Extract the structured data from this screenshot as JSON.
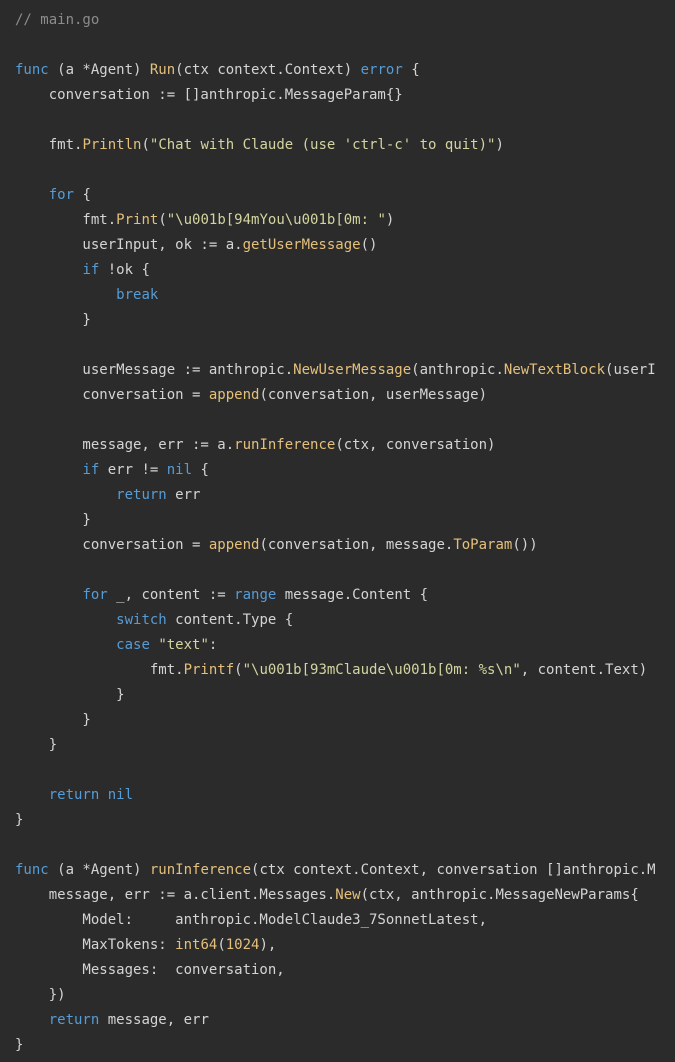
{
  "file": {
    "comment": "// main.go"
  },
  "code_lines": [
    [
      {
        "t": "comment",
        "v": "// main.go"
      }
    ],
    [],
    [
      {
        "t": "keyword",
        "v": "func"
      },
      {
        "t": "plain",
        "v": " (a *Agent) "
      },
      {
        "t": "function",
        "v": "Run"
      },
      {
        "t": "plain",
        "v": "(ctx context.Context) "
      },
      {
        "t": "keyword",
        "v": "error"
      },
      {
        "t": "plain",
        "v": " {"
      }
    ],
    [
      {
        "t": "plain",
        "v": "    conversation := []anthropic.MessageParam{}"
      }
    ],
    [],
    [
      {
        "t": "plain",
        "v": "    fmt."
      },
      {
        "t": "function",
        "v": "Println"
      },
      {
        "t": "plain",
        "v": "("
      },
      {
        "t": "string",
        "v": "\"Chat with Claude (use 'ctrl-c' to quit)\""
      },
      {
        "t": "plain",
        "v": ")"
      }
    ],
    [],
    [
      {
        "t": "plain",
        "v": "    "
      },
      {
        "t": "keyword",
        "v": "for"
      },
      {
        "t": "plain",
        "v": " {"
      }
    ],
    [
      {
        "t": "plain",
        "v": "        fmt."
      },
      {
        "t": "function",
        "v": "Print"
      },
      {
        "t": "plain",
        "v": "("
      },
      {
        "t": "string",
        "v": "\"\\u001b[94mYou\\u001b[0m: \""
      },
      {
        "t": "plain",
        "v": ")"
      }
    ],
    [
      {
        "t": "plain",
        "v": "        userInput, ok := a."
      },
      {
        "t": "function",
        "v": "getUserMessage"
      },
      {
        "t": "plain",
        "v": "()"
      }
    ],
    [
      {
        "t": "plain",
        "v": "        "
      },
      {
        "t": "keyword",
        "v": "if"
      },
      {
        "t": "plain",
        "v": " !ok {"
      }
    ],
    [
      {
        "t": "plain",
        "v": "            "
      },
      {
        "t": "keyword",
        "v": "break"
      }
    ],
    [
      {
        "t": "plain",
        "v": "        }"
      }
    ],
    [],
    [
      {
        "t": "plain",
        "v": "        userMessage := anthropic."
      },
      {
        "t": "function",
        "v": "NewUserMessage"
      },
      {
        "t": "plain",
        "v": "(anthropic."
      },
      {
        "t": "function",
        "v": "NewTextBlock"
      },
      {
        "t": "plain",
        "v": "(userI"
      }
    ],
    [
      {
        "t": "plain",
        "v": "        conversation = "
      },
      {
        "t": "function",
        "v": "append"
      },
      {
        "t": "plain",
        "v": "(conversation, userMessage)"
      }
    ],
    [],
    [
      {
        "t": "plain",
        "v": "        message, err := a."
      },
      {
        "t": "function",
        "v": "runInference"
      },
      {
        "t": "plain",
        "v": "(ctx, conversation)"
      }
    ],
    [
      {
        "t": "plain",
        "v": "        "
      },
      {
        "t": "keyword",
        "v": "if"
      },
      {
        "t": "plain",
        "v": " err != "
      },
      {
        "t": "keyword",
        "v": "nil"
      },
      {
        "t": "plain",
        "v": " {"
      }
    ],
    [
      {
        "t": "plain",
        "v": "            "
      },
      {
        "t": "keyword",
        "v": "return"
      },
      {
        "t": "plain",
        "v": " err"
      }
    ],
    [
      {
        "t": "plain",
        "v": "        }"
      }
    ],
    [
      {
        "t": "plain",
        "v": "        conversation = "
      },
      {
        "t": "function",
        "v": "append"
      },
      {
        "t": "plain",
        "v": "(conversation, message."
      },
      {
        "t": "function",
        "v": "ToParam"
      },
      {
        "t": "plain",
        "v": "())"
      }
    ],
    [],
    [
      {
        "t": "plain",
        "v": "        "
      },
      {
        "t": "keyword",
        "v": "for"
      },
      {
        "t": "plain",
        "v": " _, content := "
      },
      {
        "t": "keyword",
        "v": "range"
      },
      {
        "t": "plain",
        "v": " message.Content {"
      }
    ],
    [
      {
        "t": "plain",
        "v": "            "
      },
      {
        "t": "keyword",
        "v": "switch"
      },
      {
        "t": "plain",
        "v": " content.Type {"
      }
    ],
    [
      {
        "t": "plain",
        "v": "            "
      },
      {
        "t": "keyword",
        "v": "case"
      },
      {
        "t": "plain",
        "v": " "
      },
      {
        "t": "string",
        "v": "\"text\""
      },
      {
        "t": "plain",
        "v": ":"
      }
    ],
    [
      {
        "t": "plain",
        "v": "                fmt."
      },
      {
        "t": "function",
        "v": "Printf"
      },
      {
        "t": "plain",
        "v": "("
      },
      {
        "t": "string",
        "v": "\"\\u001b[93mClaude\\u001b[0m: %s\\n\""
      },
      {
        "t": "plain",
        "v": ", content.Text)"
      }
    ],
    [
      {
        "t": "plain",
        "v": "            }"
      }
    ],
    [
      {
        "t": "plain",
        "v": "        }"
      }
    ],
    [
      {
        "t": "plain",
        "v": "    }"
      }
    ],
    [],
    [
      {
        "t": "plain",
        "v": "    "
      },
      {
        "t": "keyword",
        "v": "return"
      },
      {
        "t": "plain",
        "v": " "
      },
      {
        "t": "keyword",
        "v": "nil"
      }
    ],
    [
      {
        "t": "plain",
        "v": "}"
      }
    ],
    [],
    [
      {
        "t": "keyword",
        "v": "func"
      },
      {
        "t": "plain",
        "v": " (a *Agent) "
      },
      {
        "t": "function",
        "v": "runInference"
      },
      {
        "t": "plain",
        "v": "(ctx context.Context, conversation []anthropic.M"
      }
    ],
    [
      {
        "t": "plain",
        "v": "    message, err := a.client.Messages."
      },
      {
        "t": "function",
        "v": "New"
      },
      {
        "t": "plain",
        "v": "(ctx, anthropic.MessageNewParams{"
      }
    ],
    [
      {
        "t": "plain",
        "v": "        Model:     anthropic.ModelClaude3_7SonnetLatest,"
      }
    ],
    [
      {
        "t": "plain",
        "v": "        MaxTokens: "
      },
      {
        "t": "function",
        "v": "int64"
      },
      {
        "t": "plain",
        "v": "("
      },
      {
        "t": "number",
        "v": "1024"
      },
      {
        "t": "plain",
        "v": "),"
      }
    ],
    [
      {
        "t": "plain",
        "v": "        Messages:  conversation,"
      }
    ],
    [
      {
        "t": "plain",
        "v": "    })"
      }
    ],
    [
      {
        "t": "plain",
        "v": "    "
      },
      {
        "t": "keyword",
        "v": "return"
      },
      {
        "t": "plain",
        "v": " message, err"
      }
    ],
    [
      {
        "t": "plain",
        "v": "}"
      }
    ]
  ]
}
